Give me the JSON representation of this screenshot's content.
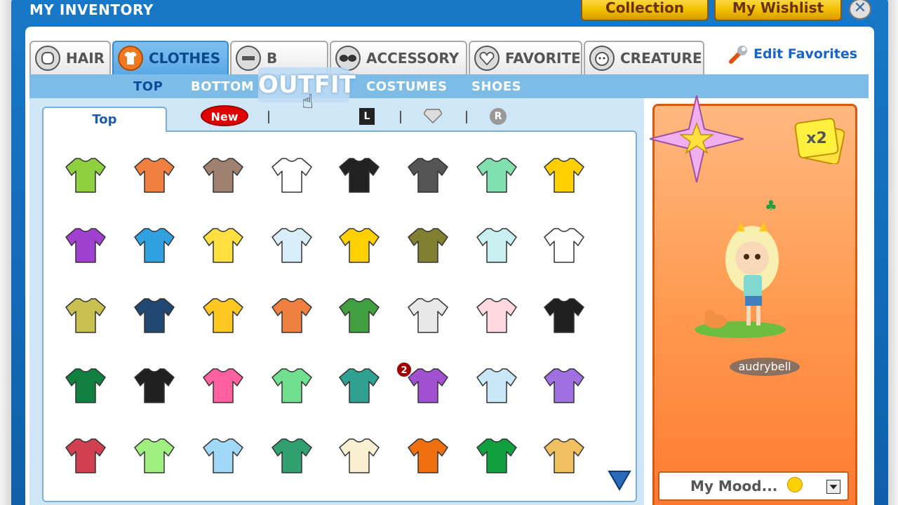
{
  "window": {
    "title": "MY INVENTORY"
  },
  "top_buttons": {
    "collection": "Collection",
    "wishlist": "My Wishlist",
    "close": "✕"
  },
  "tabs": [
    {
      "label": "HAIR",
      "icon": "hair-icon"
    },
    {
      "label": "CLOTHES",
      "icon": "shirt-icon",
      "active": true
    },
    {
      "label": "B",
      "icon": "body-icon"
    },
    {
      "label": "ACCESSORY",
      "icon": "sunglasses-icon"
    },
    {
      "label": "FAVORITE",
      "icon": "heart-icon"
    },
    {
      "label": "CREATURE",
      "icon": "creature-icon"
    }
  ],
  "edit_favorites": "Edit Favorites",
  "subtabs": [
    {
      "label": "TOP",
      "active": true
    },
    {
      "label": "BOTTOM"
    },
    {
      "label": "OUTFIT",
      "hovered": true
    },
    {
      "label": "COSTUMES"
    },
    {
      "label": "SHOES"
    }
  ],
  "panel": {
    "subtab": "Top",
    "new_badge": "New",
    "filter_l": "L",
    "filter_r": "R"
  },
  "items": [
    [
      "#8fd040",
      "#f08040",
      "#a08070",
      "#ffffff",
      "#222222",
      "#555555",
      "#80e0b0",
      "#ffd000"
    ],
    [
      "#a040d0",
      "#30a0e0",
      "#ffe040",
      "#d8eef8",
      "#ffd000",
      "#808030",
      "#c8f0f0",
      "#ffffff"
    ],
    [
      "#c8c050",
      "#204870",
      "#ffc820",
      "#f08040",
      "#40a040",
      "#e8e8e8",
      "#ffd8e0",
      "#202020"
    ],
    [
      "#108040",
      "#202020",
      "#ff60a0",
      "#70e090",
      "#30a090",
      "#a050d0",
      "#c8e8f8",
      "#a070e0"
    ],
    [
      "#d04050",
      "#a0f080",
      "#a0d8f8",
      "#30a070",
      "#f8f0d0",
      "#f07010",
      "#10a040",
      "#f0c060"
    ]
  ],
  "qty_badge": "2",
  "avatar": {
    "name": "audrybell",
    "multiplier": "x2"
  },
  "mood": {
    "label": "My Mood..."
  }
}
